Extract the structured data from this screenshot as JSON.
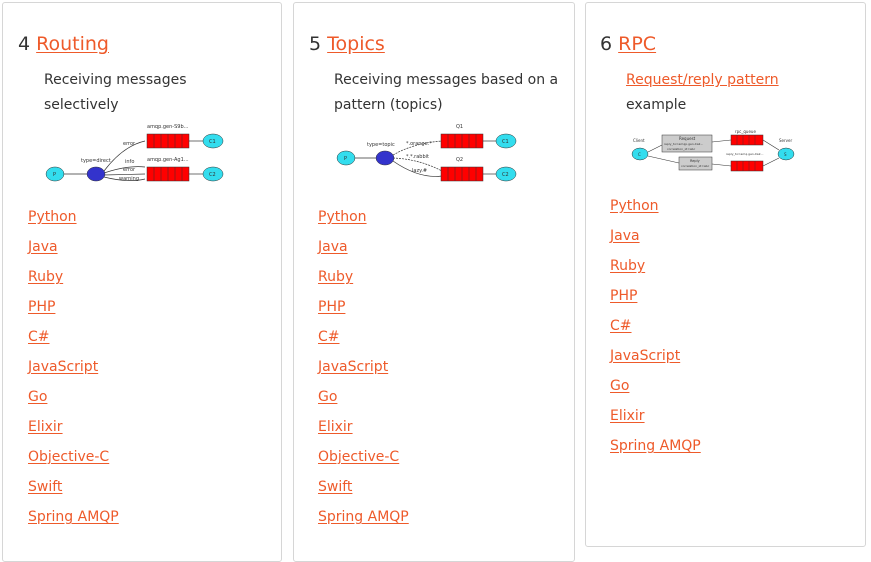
{
  "cards": [
    {
      "number": "4",
      "title": "Routing",
      "description": "Receiving messages selectively",
      "diagram": {
        "producer": "P",
        "exchange_label": "type=direct",
        "binding_top": "error",
        "binding_bottom": [
          "info",
          "error",
          "warning"
        ],
        "queue_top": "amqp.gen-S9b...",
        "queue_bottom": "amqp.gen-Ag1...",
        "consumer_top": "C1",
        "consumer_bottom": "C2"
      },
      "links": [
        "Python",
        "Java",
        "Ruby",
        "PHP",
        "C#",
        "JavaScript",
        "Go",
        "Elixir",
        "Objective-C",
        "Swift",
        "Spring AMQP"
      ]
    },
    {
      "number": "5",
      "title": "Topics",
      "description": "Receiving messages based on a pattern (topics)",
      "diagram": {
        "producer": "P",
        "exchange_label": "type=topic",
        "binding_top": "*.orange.*",
        "binding_mid": "*.*.rabbit",
        "binding_bottom": "lazy.#",
        "queue_top": "Q1",
        "queue_bottom": "Q2",
        "consumer_top": "C1",
        "consumer_bottom": "C2"
      },
      "links": [
        "Python",
        "Java",
        "Ruby",
        "PHP",
        "C#",
        "JavaScript",
        "Go",
        "Elixir",
        "Objective-C",
        "Swift",
        "Spring AMQP"
      ]
    },
    {
      "number": "6",
      "title": "RPC",
      "description_link": "Request/reply pattern",
      "description_rest": "example",
      "diagram": {
        "client": "Client",
        "server": "Server",
        "request_box": [
          "Request",
          "reply_to=amqp.gen-Xa2...",
          "correlation_id=abc"
        ],
        "reply_box": [
          "Reply",
          "correlation_id=abc"
        ],
        "queue_top": "rpc_queue",
        "queue_bottom": "reply_to=amq.gen-Xa2...",
        "client_node": "C",
        "server_node": "S"
      },
      "links": [
        "Python",
        "Java",
        "Ruby",
        "PHP",
        "C#",
        "JavaScript",
        "Go",
        "Elixir",
        "Spring AMQP"
      ]
    }
  ],
  "colors": {
    "accent": "#ee5a2a",
    "text": "#333333",
    "border": "#d6d6d6",
    "queue": "#ff0000",
    "endpoint": "#33ddee",
    "exchange": "#3333cc"
  }
}
